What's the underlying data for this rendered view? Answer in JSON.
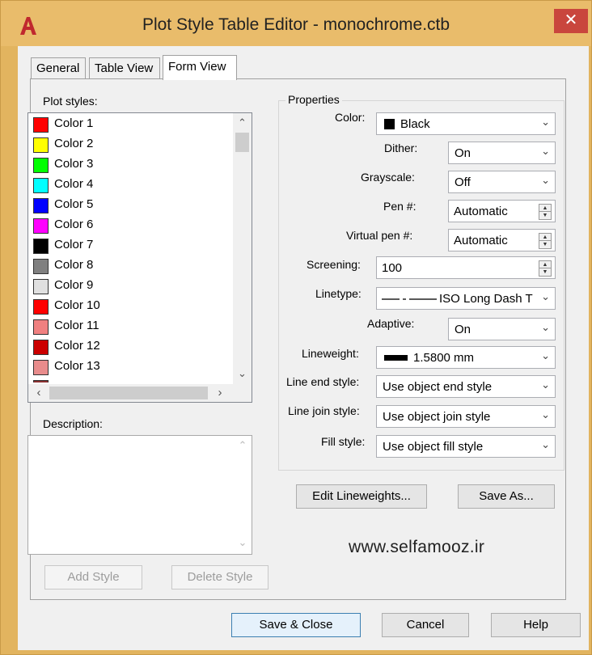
{
  "window": {
    "title": "Plot Style Table Editor - monochrome.ctb",
    "close_glyph": "✕",
    "app_icon": "autocad-icon"
  },
  "tabs": [
    {
      "label": "General",
      "active": false
    },
    {
      "label": "Table View",
      "active": false
    },
    {
      "label": "Form View",
      "active": true
    }
  ],
  "plot_styles": {
    "label": "Plot styles:",
    "items": [
      {
        "label": "Color 1",
        "color": "#ff0000"
      },
      {
        "label": "Color 2",
        "color": "#ffff00"
      },
      {
        "label": "Color 3",
        "color": "#00ff00"
      },
      {
        "label": "Color 4",
        "color": "#00ffff"
      },
      {
        "label": "Color 5",
        "color": "#0000ff"
      },
      {
        "label": "Color 6",
        "color": "#ff00ff"
      },
      {
        "label": "Color 7",
        "color": "#000000"
      },
      {
        "label": "Color 8",
        "color": "#808080"
      },
      {
        "label": "Color 9",
        "color": "#e0e0e0"
      },
      {
        "label": "Color 10",
        "color": "#ff0000"
      },
      {
        "label": "Color 11",
        "color": "#f08080"
      },
      {
        "label": "Color 12",
        "color": "#cc0000"
      },
      {
        "label": "Color 13",
        "color": "#e88c8c"
      }
    ]
  },
  "description": {
    "label": "Description:"
  },
  "buttons": {
    "add_style": "Add Style",
    "delete_style": "Delete Style",
    "edit_lineweights": "Edit Lineweights...",
    "save_as": "Save As...",
    "save_close": "Save & Close",
    "cancel": "Cancel",
    "help": "Help"
  },
  "properties": {
    "title": "Properties",
    "color": {
      "label": "Color:",
      "value": "Black",
      "swatch": "#000000"
    },
    "dither": {
      "label": "Dither:",
      "value": "On"
    },
    "grayscale": {
      "label": "Grayscale:",
      "value": "Off"
    },
    "pen": {
      "label": "Pen #:",
      "value": "Automatic"
    },
    "virtual_pen": {
      "label": "Virtual pen #:",
      "value": "Automatic"
    },
    "screening": {
      "label": "Screening:",
      "value": "100"
    },
    "linetype": {
      "label": "Linetype:",
      "value": "ISO Long Dash T"
    },
    "adaptive": {
      "label": "Adaptive:",
      "value": "On"
    },
    "lineweight": {
      "label": "Lineweight:",
      "value": "1.5800 mm"
    },
    "line_end": {
      "label": "Line end style:",
      "value": "Use object end style"
    },
    "line_join": {
      "label": "Line join style:",
      "value": "Use object join style"
    },
    "fill": {
      "label": "Fill style:",
      "value": "Use object fill style"
    }
  },
  "watermark": "www.selfamooz.ir"
}
